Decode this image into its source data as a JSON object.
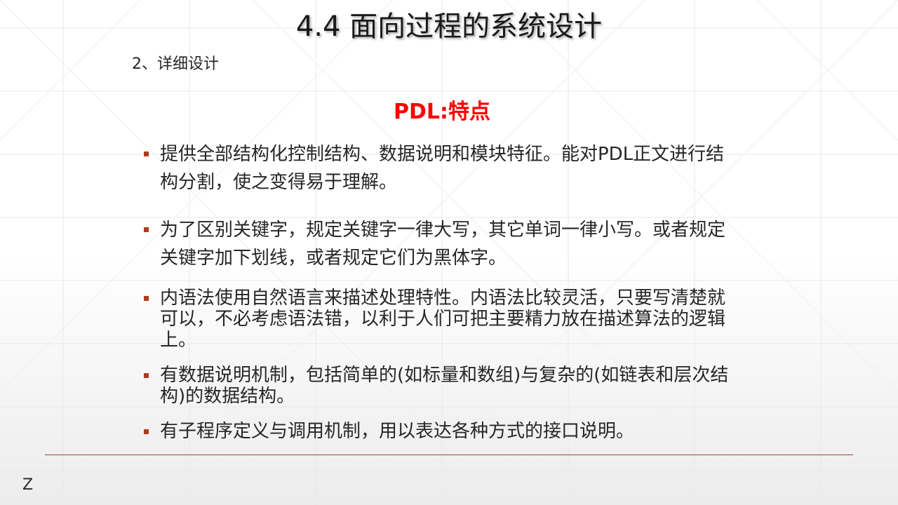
{
  "slide": {
    "title": "4.4 面向过程的系统设计",
    "subtitle": "2、详细设计",
    "heading": "PDL:特点",
    "bullets": [
      "提供全部结构化控制结构、数据说明和模块特征。能对PDL正文进行结构分割，使之变得易于理解。",
      "为了区别关键字，规定关键字一律大写，其它单词一律小写。或者规定关键字加下划线，或者规定它们为黑体字。",
      "内语法使用自然语言来描述处理特性。内语法比较灵活，只要写清楚就可以，不必考虑语法错，以利于人们可把主要精力放在描述算法的逻辑上。",
      "有数据说明机制，包括简单的(如标量和数组)与复杂的(如链表和层次结构)的数据结构。",
      "有子程序定义与调用机制，用以表达各种方式的接口说明。"
    ],
    "footer_mark": "Z"
  },
  "colors": {
    "heading": "#ff0000",
    "bullet_mark": "#b03a1e",
    "divider": "#a0412a",
    "text": "#262626"
  }
}
